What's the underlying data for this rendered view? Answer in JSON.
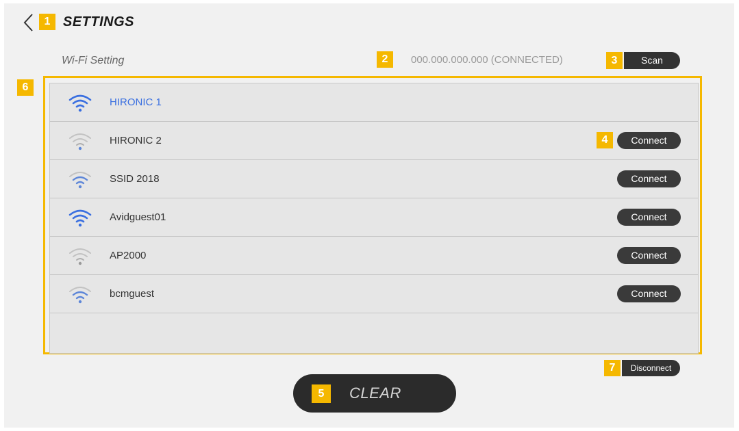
{
  "header": {
    "title": "SETTINGS",
    "back_icon": "chevron-left-icon"
  },
  "wifi": {
    "section_label": "Wi-Fi Setting",
    "status_text": "000.000.000.000 (CONNECTED)",
    "scan_label": "Scan",
    "networks": [
      {
        "ssid": "HIRONIC 1",
        "connected": true,
        "signal": "strong",
        "icon_color": "#3a6fe0",
        "action_label": ""
      },
      {
        "ssid": "HIRONIC 2",
        "connected": false,
        "signal": "weak",
        "icon_color": "#b5b5b5",
        "action_label": "Connect"
      },
      {
        "ssid": "SSID 2018",
        "connected": false,
        "signal": "medium",
        "icon_color": "#5d86d8",
        "action_label": "Connect"
      },
      {
        "ssid": "Avidguest01",
        "connected": false,
        "signal": "strong",
        "icon_color": "#3a6fe0",
        "action_label": "Connect"
      },
      {
        "ssid": "AP2000",
        "connected": false,
        "signal": "weak",
        "icon_color": "#b5b5b5",
        "action_label": "Connect"
      },
      {
        "ssid": "bcmguest",
        "connected": false,
        "signal": "medium",
        "icon_color": "#5d86d8",
        "action_label": "Connect"
      }
    ],
    "disconnect_label": "Disconnect"
  },
  "clear_label": "CLEAR",
  "annotations": [
    "1",
    "2",
    "3",
    "4",
    "5",
    "6",
    "7"
  ],
  "colors": {
    "accent": "#f5b800",
    "button_dark": "#333333",
    "active_text": "#3a6fe0"
  }
}
